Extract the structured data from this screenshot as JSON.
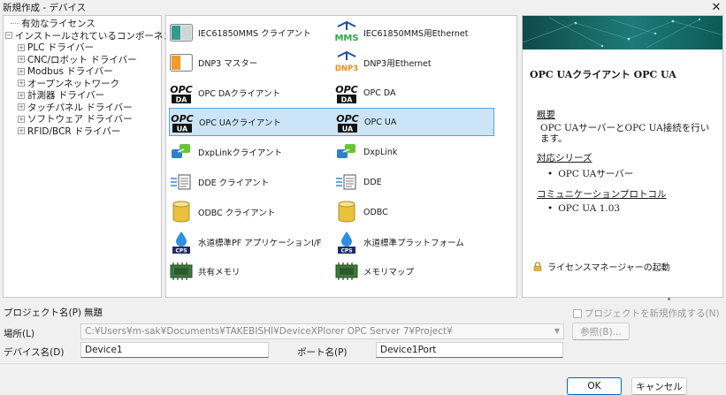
{
  "window": {
    "title": "新規作成 - デバイス",
    "close_glyph": "✕"
  },
  "tree": {
    "items": [
      {
        "label": "有効なライセンス",
        "indent": 1,
        "expander": ""
      },
      {
        "label": "インストールされているコンポーネント",
        "indent": 0,
        "expander": "−"
      },
      {
        "label": "PLC ドライバー",
        "indent": 2,
        "expander": "+"
      },
      {
        "label": "CNC/ロボット ドライバー",
        "indent": 2,
        "expander": "+"
      },
      {
        "label": "Modbus ドライバー",
        "indent": 2,
        "expander": "+"
      },
      {
        "label": "オープンネットワーク",
        "indent": 2,
        "expander": "+"
      },
      {
        "label": "計測器 ドライバー",
        "indent": 2,
        "expander": "+"
      },
      {
        "label": "タッチパネル ドライバー",
        "indent": 2,
        "expander": "+"
      },
      {
        "label": "ソフトウェア ドライバー",
        "indent": 2,
        "expander": "+"
      },
      {
        "label": "RFID/BCR ドライバー",
        "indent": 2,
        "expander": "+"
      }
    ]
  },
  "list": {
    "items": [
      {
        "label": "IEC61850MMS クライアント",
        "icon": "iec61850-client-icon",
        "col": 0,
        "row": 0
      },
      {
        "label": "IEC61850MMS用Ethernet",
        "icon": "mms-ethernet-icon",
        "col": 1,
        "row": 0
      },
      {
        "label": "DNP3 マスター",
        "icon": "dnp3-master-icon",
        "col": 0,
        "row": 1
      },
      {
        "label": "DNP3用Ethernet",
        "icon": "dnp3-ethernet-icon",
        "col": 1,
        "row": 1
      },
      {
        "label": "OPC DAクライアント",
        "icon": "opc-da-icon",
        "col": 0,
        "row": 2
      },
      {
        "label": "OPC DA",
        "icon": "opc-da-icon",
        "col": 1,
        "row": 2
      },
      {
        "label": "OPC UAクライアント",
        "icon": "opc-ua-icon",
        "col": 0,
        "row": 3,
        "selected": true
      },
      {
        "label": "OPC UA",
        "icon": "opc-ua-icon",
        "col": 1,
        "row": 3,
        "selected": true
      },
      {
        "label": "DxpLinkクライアント",
        "icon": "dxplink-icon",
        "col": 0,
        "row": 4
      },
      {
        "label": "DxpLink",
        "icon": "dxplink-icon",
        "col": 1,
        "row": 4
      },
      {
        "label": "DDE クライアント",
        "icon": "dde-icon",
        "col": 0,
        "row": 5
      },
      {
        "label": "DDE",
        "icon": "dde-icon",
        "col": 1,
        "row": 5
      },
      {
        "label": "ODBC クライアント",
        "icon": "odbc-icon",
        "col": 0,
        "row": 6
      },
      {
        "label": "ODBC",
        "icon": "odbc-icon",
        "col": 1,
        "row": 6
      },
      {
        "label": "水道標準PF アプリケーションI/F",
        "icon": "cps-water-icon",
        "col": 0,
        "row": 7
      },
      {
        "label": "水道標準プラットフォーム",
        "icon": "cps-water-icon",
        "col": 1,
        "row": 7
      },
      {
        "label": "共有メモリ",
        "icon": "memory-chip-icon",
        "col": 0,
        "row": 8
      },
      {
        "label": "メモリマップ",
        "icon": "memory-chip-icon",
        "col": 1,
        "row": 8
      }
    ],
    "icon_text": {
      "opc": "OPC",
      "ua": "UA",
      "da": "DA",
      "mms": "MMS",
      "dnp3": "DNP3",
      "cps": "CPS"
    }
  },
  "description": {
    "heading": "OPC UAクライアント OPC UA",
    "overview_title": "概要",
    "overview_body": "OPC UAサーバーとOPC UA接続を行います。",
    "series_title": "対応シリーズ",
    "series_items": [
      "OPC UAサーバー"
    ],
    "protocol_title": "コミュニケーションプロトコル",
    "protocol_items": [
      "OPC UA 1.03"
    ],
    "license_label": "ライセンスマネージャーの起動"
  },
  "form": {
    "project_label": "プロジェクト名(P)",
    "project_value": "無題",
    "new_project_label": "プロジェクトを新規作成する(N)",
    "location_label": "場所(L)",
    "location_value": "C:¥Users¥m-sak¥Documents¥TAKEBISHI¥DeviceXPlorer OPC Server 7¥Project¥",
    "browse_label": "参照(B)...",
    "device_label": "デバイス名(D)",
    "device_value": "Device1",
    "port_label": "ポート名(P)",
    "port_value": "Device1Port"
  },
  "buttons": {
    "ok": "OK",
    "cancel": "キャンセル"
  },
  "colors": {
    "selection_bg": "#cce4f7",
    "selection_border": "#5ea1d8",
    "banner": "#1f7a77"
  }
}
